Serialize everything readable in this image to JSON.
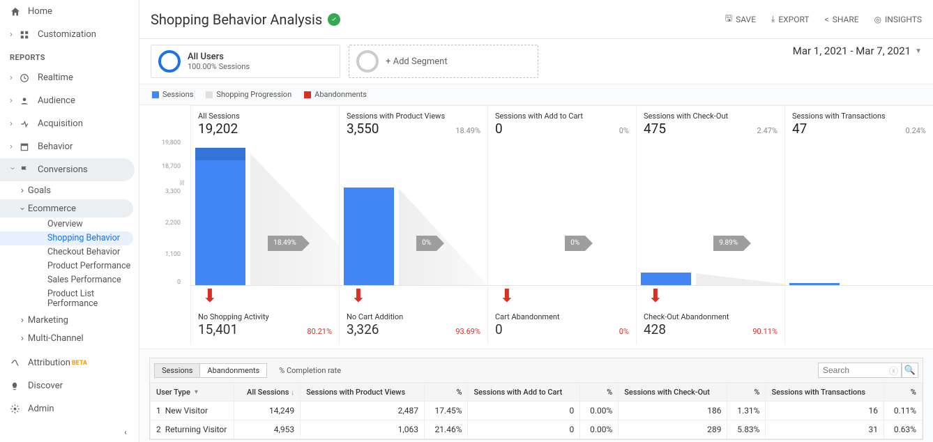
{
  "sidebar": {
    "home": "Home",
    "customization": "Customization",
    "section": "REPORTS",
    "realtime": "Realtime",
    "audience": "Audience",
    "acquisition": "Acquisition",
    "behavior": "Behavior",
    "conversions": "Conversions",
    "goals": "Goals",
    "ecommerce": "Ecommerce",
    "overview": "Overview",
    "shopping_behavior": "Shopping Behavior",
    "checkout_behavior": "Checkout Behavior",
    "product_perf": "Product Performance",
    "sales_perf": "Sales Performance",
    "product_list_perf": "Product List Performance",
    "marketing": "Marketing",
    "multichannel": "Multi-Channel",
    "attribution": "Attribution",
    "attribution_badge": "BETA",
    "discover": "Discover",
    "admin": "Admin"
  },
  "toolbar": {
    "title": "Shopping Behavior Analysis",
    "save": "SAVE",
    "export": "EXPORT",
    "share": "SHARE",
    "insights": "INSIGHTS"
  },
  "segments": {
    "all_users": "All Users",
    "all_users_sub": "100.00% Sessions",
    "add": "+ Add Segment"
  },
  "daterange": "Mar 1, 2021 - Mar 7, 2021",
  "legend": {
    "sessions": "Sessions",
    "progression": "Shopping Progression",
    "abandonments": "Abandonments"
  },
  "colors": {
    "sessions": "#4285f4",
    "progression": "#e0e0e0",
    "abandonments": "#d93025"
  },
  "yticks": [
    "19,800",
    "18,700",
    "3,300",
    "2,200",
    "1,100",
    "0"
  ],
  "chart_data": {
    "type": "bar",
    "title": "Shopping Behavior Analysis",
    "xlabel": "",
    "ylabel": "Sessions",
    "broken_axis_between": [
      3300,
      18700
    ],
    "stages": [
      {
        "label": "All Sessions",
        "value": 19202,
        "pct": null,
        "progression_pct": 18.49,
        "abandon_label": "No Shopping Activity",
        "abandon_value": 15401,
        "abandon_pct": 80.21
      },
      {
        "label": "Sessions with Product Views",
        "value": 3550,
        "pct": 18.49,
        "progression_pct": 0.0,
        "abandon_label": "No Cart Addition",
        "abandon_value": 3326,
        "abandon_pct": 93.69
      },
      {
        "label": "Sessions with Add to Cart",
        "value": 0,
        "pct": 0.0,
        "progression_pct": 0.0,
        "abandon_label": "Cart Abandonment",
        "abandon_value": 0,
        "abandon_pct": 0.0
      },
      {
        "label": "Sessions with Check-Out",
        "value": 475,
        "pct": 2.47,
        "progression_pct": 9.89,
        "abandon_label": "Check-Out Abandonment",
        "abandon_value": 428,
        "abandon_pct": 90.11
      },
      {
        "label": "Sessions with Transactions",
        "value": 47,
        "pct": 0.24,
        "progression_pct": null,
        "abandon_label": null,
        "abandon_value": null,
        "abandon_pct": null
      }
    ]
  },
  "stages_fmt": [
    {
      "label": "All Sessions",
      "value": "19,202",
      "pct": ""
    },
    {
      "label": "Sessions with Product Views",
      "value": "3,550",
      "pct": "18.49%"
    },
    {
      "label": "Sessions with Add to Cart",
      "value": "0",
      "pct": "0%"
    },
    {
      "label": "Sessions with Check-Out",
      "value": "475",
      "pct": "2.47%"
    },
    {
      "label": "Sessions with Transactions",
      "value": "47",
      "pct": "0.24%"
    }
  ],
  "progress_fmt": [
    "18.49%",
    "0%",
    "0%",
    "9.89%"
  ],
  "aband_fmt": [
    {
      "label": "No Shopping Activity",
      "value": "15,401",
      "pct": "80.21%"
    },
    {
      "label": "No Cart Addition",
      "value": "3,326",
      "pct": "93.69%"
    },
    {
      "label": "Cart Abandonment",
      "value": "0",
      "pct": "0%"
    },
    {
      "label": "Check-Out Abandonment",
      "value": "428",
      "pct": "90.11%"
    }
  ],
  "tabletabs": {
    "sessions": "Sessions",
    "abandon": "Abandonments",
    "completion": "% Completion rate"
  },
  "search_placeholder": "Search",
  "table": {
    "headers": {
      "usertype": "User Type",
      "all": "All Sessions",
      "pv": "Sessions with Product Views",
      "pv_pct": "%",
      "cart": "Sessions with Add to Cart",
      "cart_pct": "%",
      "co": "Sessions with Check-Out",
      "co_pct": "%",
      "tx": "Sessions with Transactions",
      "tx_pct": "%"
    },
    "rows": [
      {
        "n": "1",
        "ut": "New Visitor",
        "all": "14,249",
        "pv": "2,487",
        "pv_pct": "17.45%",
        "cart": "0",
        "cart_pct": "0.00%",
        "co": "186",
        "co_pct": "1.31%",
        "tx": "16",
        "tx_pct": "0.11%"
      },
      {
        "n": "2",
        "ut": "Returning Visitor",
        "all": "4,953",
        "pv": "1,063",
        "pv_pct": "21.46%",
        "cart": "0",
        "cart_pct": "0.00%",
        "co": "289",
        "co_pct": "5.83%",
        "tx": "31",
        "tx_pct": "0.63%"
      }
    ]
  }
}
